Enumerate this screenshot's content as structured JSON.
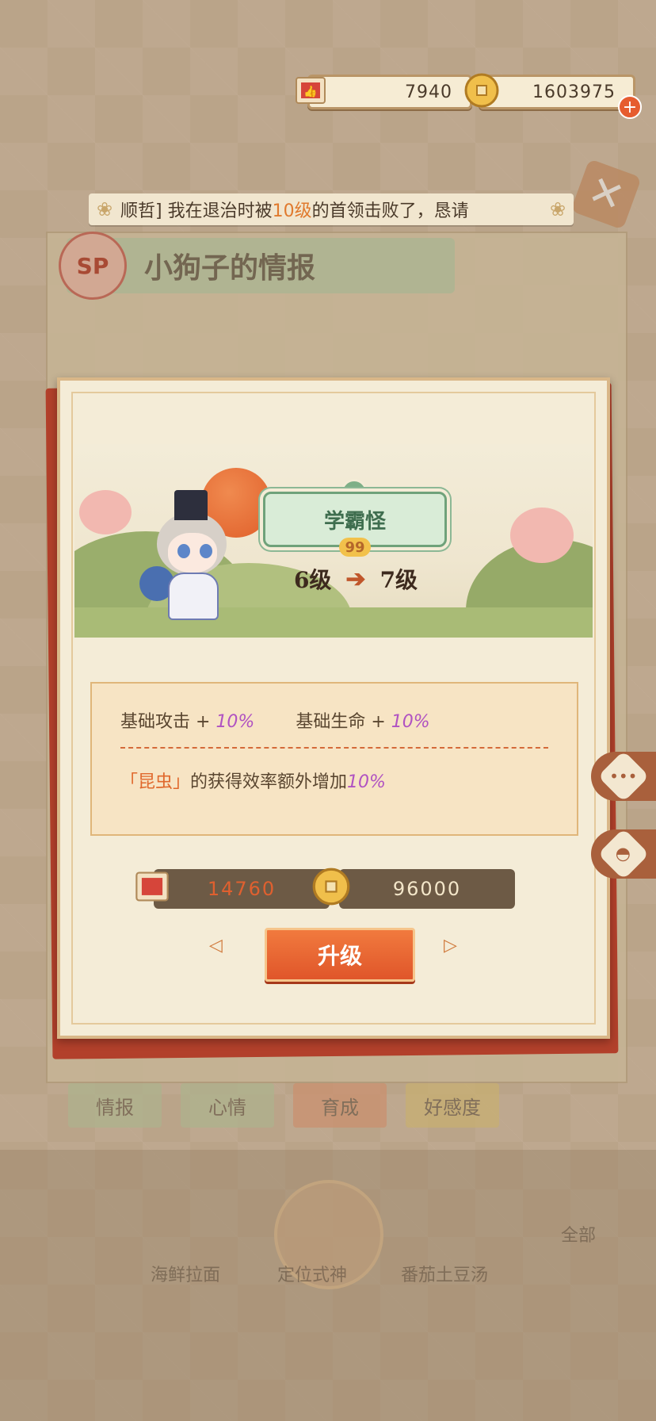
{
  "currency": {
    "likes": "7940",
    "coins": "1603975"
  },
  "ticker": {
    "prefix": "顺哲] 我在退治时被",
    "highlight": "10级",
    "suffix": "的首领击败了，恳请"
  },
  "background": {
    "badge": "SP",
    "title": "小狗子的情报"
  },
  "modal": {
    "plate_title": "学霸怪",
    "plate_number": "99",
    "level_from": "6级",
    "level_to": "7级",
    "stat1_label": "基础攻击 +",
    "stat1_value": "10%",
    "stat2_label": "基础生命 +",
    "stat2_value": "10%",
    "bonus_highlight": "「昆虫」",
    "bonus_text": "的获得效率额外增加",
    "bonus_value": "10%",
    "cost_likes": "14760",
    "cost_coins": "96000",
    "upgrade_label": "升级"
  },
  "tabs": [
    "情报",
    "心情",
    "育成",
    "好感度"
  ],
  "bottom": {
    "center_label": "定位式神",
    "label_left": "海鲜拉面",
    "label_right": "番茄土豆汤",
    "label_all": "全部"
  },
  "colors": {
    "accent": "#e0562a",
    "modal_bg": "#f4ecd7",
    "frame_red": "#b2402b",
    "highlight_purple": "#b052c2"
  }
}
